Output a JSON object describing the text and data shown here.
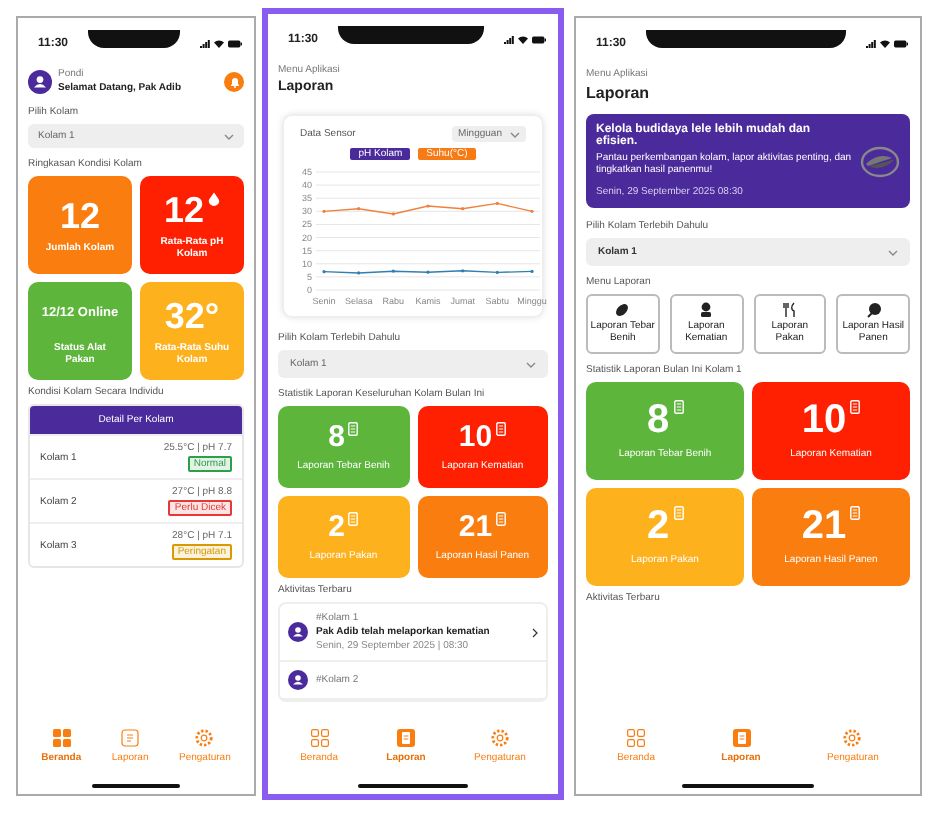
{
  "screens": [
    {
      "highlighted": false,
      "time": "11:30",
      "sections": [
        {
          "kind": "profile",
          "caption": "Pondi",
          "greeting": "Selamat Datang, Pak Adib"
        },
        {
          "kind": "label",
          "text": "Pilih Kolam"
        },
        {
          "kind": "select",
          "value": "Kolam 1"
        },
        {
          "kind": "label",
          "text": "Ringkasan Kondisi Kolam"
        },
        {
          "kind": "tiles",
          "tiles": [
            {
              "kind": "number",
              "value": "12",
              "label": "Jumlah Kolam",
              "color": "#f97d0f"
            },
            {
              "kind": "ph",
              "value": "12",
              "label": "Rata-Rata pH Kolam",
              "color": "#fe2000"
            },
            {
              "kind": "status",
              "value": "12/12 Online",
              "label": "Status Alat Pakan",
              "color": "#5db53c"
            },
            {
              "kind": "number",
              "value": "32°",
              "label": "Rata-Rata Suhu Kolam",
              "color": "#fdb11d"
            }
          ]
        },
        {
          "kind": "label",
          "text": "Kondisi Kolam Secara Individu"
        },
        {
          "kind": "pond_table",
          "title": "Detail Per Kolam",
          "rows": [
            {
              "name": "Kolam 1",
              "reading": "25.5°C | pH 7.7",
              "status": "Normal",
              "color": "#2f9e4a"
            },
            {
              "name": "Kolam 2",
              "reading": "27°C | pH 8.8",
              "status": "Perlu Dicek",
              "color": "#e53935"
            },
            {
              "name": "Kolam 3",
              "reading": "28°C | pH 7.1",
              "status": "Peringatan",
              "color": "#d89a00"
            }
          ]
        }
      ],
      "nav": [
        {
          "kind": "home",
          "label": "Beranda",
          "selected": true
        },
        {
          "kind": "report",
          "label": "Laporan",
          "selected": false
        },
        {
          "kind": "settings",
          "label": "Pengaturan",
          "selected": false
        }
      ]
    },
    {
      "highlighted": true,
      "time": "11:30",
      "sections": [
        {
          "kind": "title",
          "caption": "Menu Aplikasi",
          "heading": "Laporan"
        },
        {
          "kind": "chart",
          "title": "Data Sensor",
          "filter": "Mingguan",
          "legend": [
            {
              "color": "#4b2a9b"
            },
            {
              "color": "#f77b15"
            }
          ],
          "chart_data": {
            "type": "line",
            "grid": true,
            "categories": [
              "Senin",
              "Selasa",
              "Rabu",
              "Kamis",
              "Jumat",
              "Sabtu",
              "Minggu"
            ],
            "series": [
              {
                "name": "pH Kolam",
                "color": "#2f7fb0",
                "values": [
                  7,
                  6.5,
                  7.2,
                  6.8,
                  7.3,
                  6.7,
                  7.1
                ]
              },
              {
                "name": "Suhu(°C)",
                "color": "#f0803c",
                "values": [
                  30,
                  31,
                  29,
                  32,
                  31,
                  33,
                  30
                ]
              }
            ],
            "ylim": [
              0,
              45
            ],
            "yticks": [
              0,
              5,
              10,
              15,
              20,
              25,
              30,
              35,
              40,
              45
            ]
          }
        },
        {
          "kind": "label",
          "text": "Pilih Kolam Terlebih Dahulu"
        },
        {
          "kind": "select",
          "value": "Kolam 1"
        },
        {
          "kind": "label",
          "text": "Statistik Laporan Keseluruhan Kolam Bulan Ini"
        },
        {
          "kind": "tiles",
          "tiles": [
            {
              "kind": "report",
              "value": "8",
              "label": "Laporan Tebar Benih",
              "color": "#5db53c"
            },
            {
              "kind": "report",
              "value": "10",
              "label": "Laporan Kematian",
              "color": "#fe2000"
            },
            {
              "kind": "report",
              "value": "2",
              "label": "Laporan Pakan",
              "color": "#fdb11d"
            },
            {
              "kind": "report",
              "value": "21",
              "label": "Laporan Hasil Panen",
              "color": "#f97d0f"
            }
          ]
        },
        {
          "kind": "label",
          "text": "Aktivitas Terbaru"
        },
        {
          "kind": "activity",
          "items": [
            {
              "tag": "#Kolam 1",
              "text": "Pak Adib telah melaporkan kematian",
              "time": "Senin, 29 September 2025 | 08:30"
            },
            {
              "tag": "#Kolam 2"
            }
          ]
        }
      ],
      "nav": [
        {
          "kind": "home",
          "label": "Beranda",
          "selected": false
        },
        {
          "kind": "report",
          "label": "Laporan",
          "selected": true
        },
        {
          "kind": "settings",
          "label": "Pengaturan",
          "selected": false
        }
      ]
    },
    {
      "highlighted": false,
      "time": "11:30",
      "sections": [
        {
          "kind": "title",
          "caption": "Menu Aplikasi",
          "heading": "Laporan"
        },
        {
          "kind": "banner",
          "heading": "Kelola budidaya lele lebih mudah dan efisien.",
          "body": "Pantau perkembangan kolam, lapor aktivitas penting, dan tingkatkan hasil panenmu!",
          "time": "Senin, 29 September 2025 08:30"
        },
        {
          "kind": "label",
          "text": "Pilih Kolam Terlebih Dahulu"
        },
        {
          "kind": "select",
          "value": "Kolam 1"
        },
        {
          "kind": "label",
          "text": "Menu Laporan"
        },
        {
          "kind": "menu",
          "items": [
            {
              "kind": "seed",
              "label": "Laporan Tebar Benih"
            },
            {
              "kind": "death",
              "label": "Laporan Kematian"
            },
            {
              "kind": "feed",
              "label": "Laporan Pakan"
            },
            {
              "kind": "harvest",
              "label": "Laporan Hasil Panen"
            }
          ]
        },
        {
          "kind": "label",
          "text": "Statistik Laporan Bulan Ini Kolam 1"
        },
        {
          "kind": "tiles",
          "tiles": [
            {
              "kind": "report",
              "value": "8",
              "label": "Laporan Tebar Benih",
              "color": "#5db53c"
            },
            {
              "kind": "report",
              "value": "10",
              "label": "Laporan Kematian",
              "color": "#fe2000"
            },
            {
              "kind": "report",
              "value": "2",
              "label": "Laporan Pakan",
              "color": "#fdb11d"
            },
            {
              "kind": "report",
              "value": "21",
              "label": "Laporan Hasil Panen",
              "color": "#f97d0f"
            }
          ]
        },
        {
          "kind": "label",
          "text": "Aktivitas Terbaru"
        }
      ],
      "nav": [
        {
          "kind": "home",
          "label": "Beranda",
          "selected": false
        },
        {
          "kind": "report",
          "label": "Laporan",
          "selected": true
        },
        {
          "kind": "settings",
          "label": "Pengaturan",
          "selected": false
        }
      ]
    }
  ]
}
